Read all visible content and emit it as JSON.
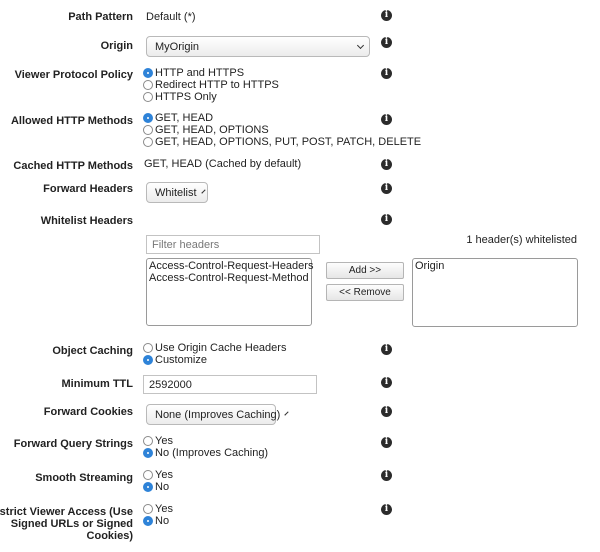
{
  "path_pattern": {
    "label": "Path Pattern",
    "value": "Default (*)"
  },
  "origin": {
    "label": "Origin",
    "selected": "MyOrigin"
  },
  "viewer_protocol_policy": {
    "label": "Viewer Protocol Policy",
    "options": [
      "HTTP and HTTPS",
      "Redirect HTTP to HTTPS",
      "HTTPS Only"
    ],
    "selected_index": 0
  },
  "allowed_http_methods": {
    "label": "Allowed HTTP Methods",
    "options": [
      "GET, HEAD",
      "GET, HEAD, OPTIONS",
      "GET, HEAD, OPTIONS, PUT, POST, PATCH, DELETE"
    ],
    "selected_index": 0
  },
  "cached_http_methods": {
    "label": "Cached HTTP Methods",
    "value": "GET, HEAD (Cached by default)"
  },
  "forward_headers": {
    "label": "Forward Headers",
    "selected": "Whitelist"
  },
  "whitelist_headers": {
    "label": "Whitelist Headers",
    "filter_placeholder": "Filter headers",
    "count_text": "1 header(s) whitelisted",
    "available": [
      "Access-Control-Request-Headers",
      "Access-Control-Request-Method"
    ],
    "whitelisted": [
      "Origin"
    ],
    "add_label": "Add >>",
    "remove_label": "<< Remove"
  },
  "object_caching": {
    "label": "Object Caching",
    "options": [
      "Use Origin Cache Headers",
      "Customize"
    ],
    "selected_index": 1
  },
  "minimum_ttl": {
    "label": "Minimum TTL",
    "value": "2592000"
  },
  "forward_cookies": {
    "label": "Forward Cookies",
    "selected": "None (Improves Caching)"
  },
  "forward_query_strings": {
    "label": "Forward Query Strings",
    "options": [
      "Yes",
      "No (Improves Caching)"
    ],
    "selected_index": 1
  },
  "smooth_streaming": {
    "label": "Smooth Streaming",
    "options": [
      "Yes",
      "No"
    ],
    "selected_index": 1
  },
  "restrict_viewer_access": {
    "label": "Restrict Viewer Access (Use Signed URLs or Signed Cookies)",
    "options": [
      "Yes",
      "No"
    ],
    "selected_index": 1
  },
  "colors": {
    "accent": "#2e83d8",
    "info_icon": "#2b2b2b"
  },
  "icons": {
    "info": "info-icon",
    "chevron": "chevron-down-icon"
  }
}
